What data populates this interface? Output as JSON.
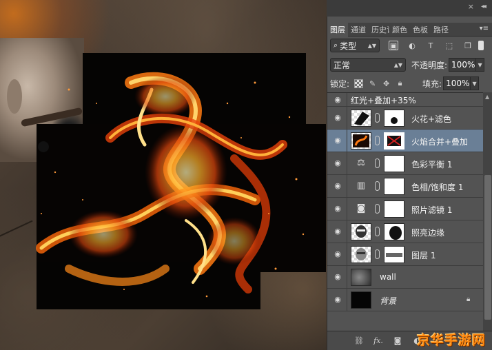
{
  "panel": {
    "tabs": [
      {
        "label": "图层",
        "active": true
      },
      {
        "label": "通道",
        "active": false
      },
      {
        "label": "历史记",
        "active": false
      },
      {
        "label": "颜色",
        "active": false
      },
      {
        "label": "色板",
        "active": false
      },
      {
        "label": "路径",
        "active": false
      }
    ],
    "filter": {
      "label": "类型"
    },
    "blend_mode": "正常",
    "opacity_label": "不透明度:",
    "opacity_value": "100%",
    "lock_label": "锁定:",
    "fill_label": "填充:",
    "fill_value": "100%",
    "layers": [
      {
        "name": "红光+叠加+35%",
        "visible": true,
        "selected": false
      },
      {
        "name": "火花+滤色",
        "visible": true,
        "selected": false
      },
      {
        "name": "火焰合并+叠加",
        "visible": true,
        "selected": true
      },
      {
        "name": "色彩平衡 1",
        "visible": true,
        "selected": false,
        "adjustment_icon": "scales-icon"
      },
      {
        "name": "色相/饱和度 1",
        "visible": true,
        "selected": false,
        "adjustment_icon": "hue-saturation-icon"
      },
      {
        "name": "照片滤镜 1",
        "visible": true,
        "selected": false,
        "adjustment_icon": "camera-icon"
      },
      {
        "name": "照亮边缘",
        "visible": true,
        "selected": false
      },
      {
        "name": "图层 1",
        "visible": true,
        "selected": false
      },
      {
        "name": "wall",
        "visible": true,
        "selected": false
      },
      {
        "name": "背景",
        "visible": true,
        "selected": false,
        "locked": true
      }
    ]
  },
  "watermark": "京华手游网",
  "colors": {
    "panel_bg": "#535353",
    "selected_layer": "#6a7f96",
    "watermark": "#ff8a10"
  }
}
